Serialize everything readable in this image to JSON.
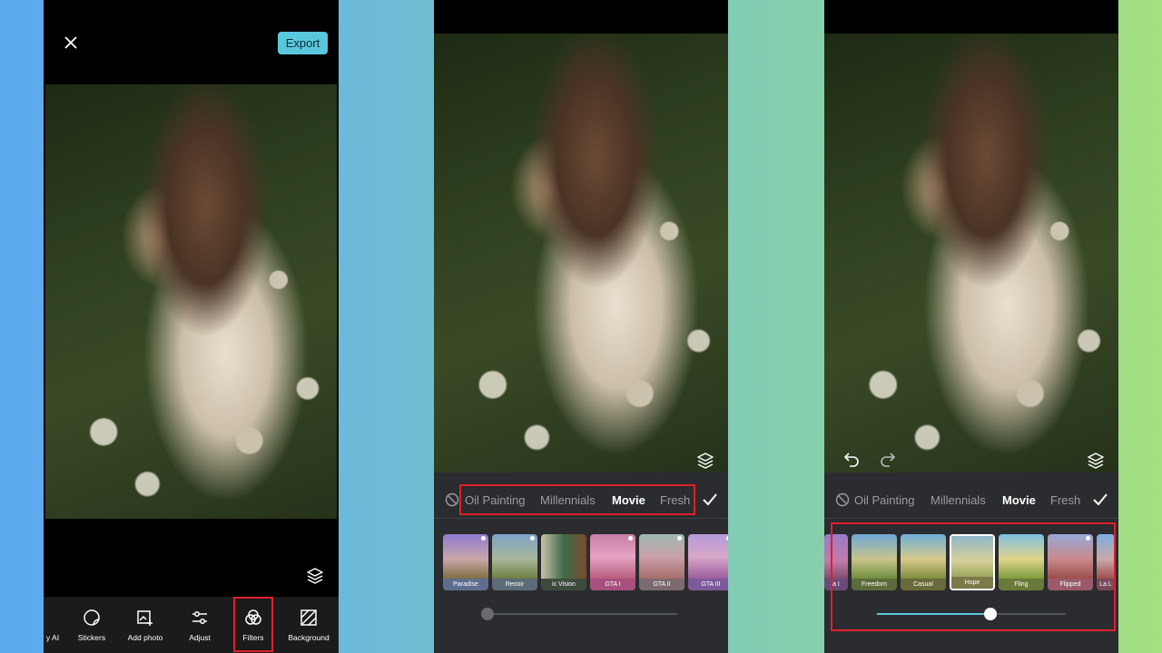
{
  "colors": {
    "accent": "#5ac8dc",
    "highlight": "#e0202a",
    "panel": "#2b2c2f"
  },
  "screen1": {
    "export_label": "Export",
    "close_icon": "close-icon",
    "toolbar": [
      {
        "label": "y AI",
        "icon": "ai-icon"
      },
      {
        "label": "Stickers",
        "icon": "sticker-icon"
      },
      {
        "label": "Add photo",
        "icon": "add-photo-icon"
      },
      {
        "label": "Adjust",
        "icon": "sliders-icon"
      },
      {
        "label": "Filters",
        "icon": "filters-icon"
      },
      {
        "label": "Background",
        "icon": "background-icon"
      }
    ]
  },
  "screen2": {
    "categories": [
      "Oil Painting",
      "Millennials",
      "Movie",
      "Fresh"
    ],
    "active_category": "Movie",
    "filters": [
      "Paradise",
      "Renoir",
      "ic Vision",
      "GTA I",
      "GTA II",
      "GTA III"
    ],
    "intensity": 0
  },
  "screen3": {
    "categories": [
      "Oil Painting",
      "Millennials",
      "Movie",
      "Fresh"
    ],
    "active_category": "Movie",
    "filters": [
      "a I",
      "Freedom",
      "Casual",
      "Hope",
      "Fling",
      "Flipped",
      "La L"
    ],
    "selected_filter": "Hope",
    "intensity": 0.6
  }
}
